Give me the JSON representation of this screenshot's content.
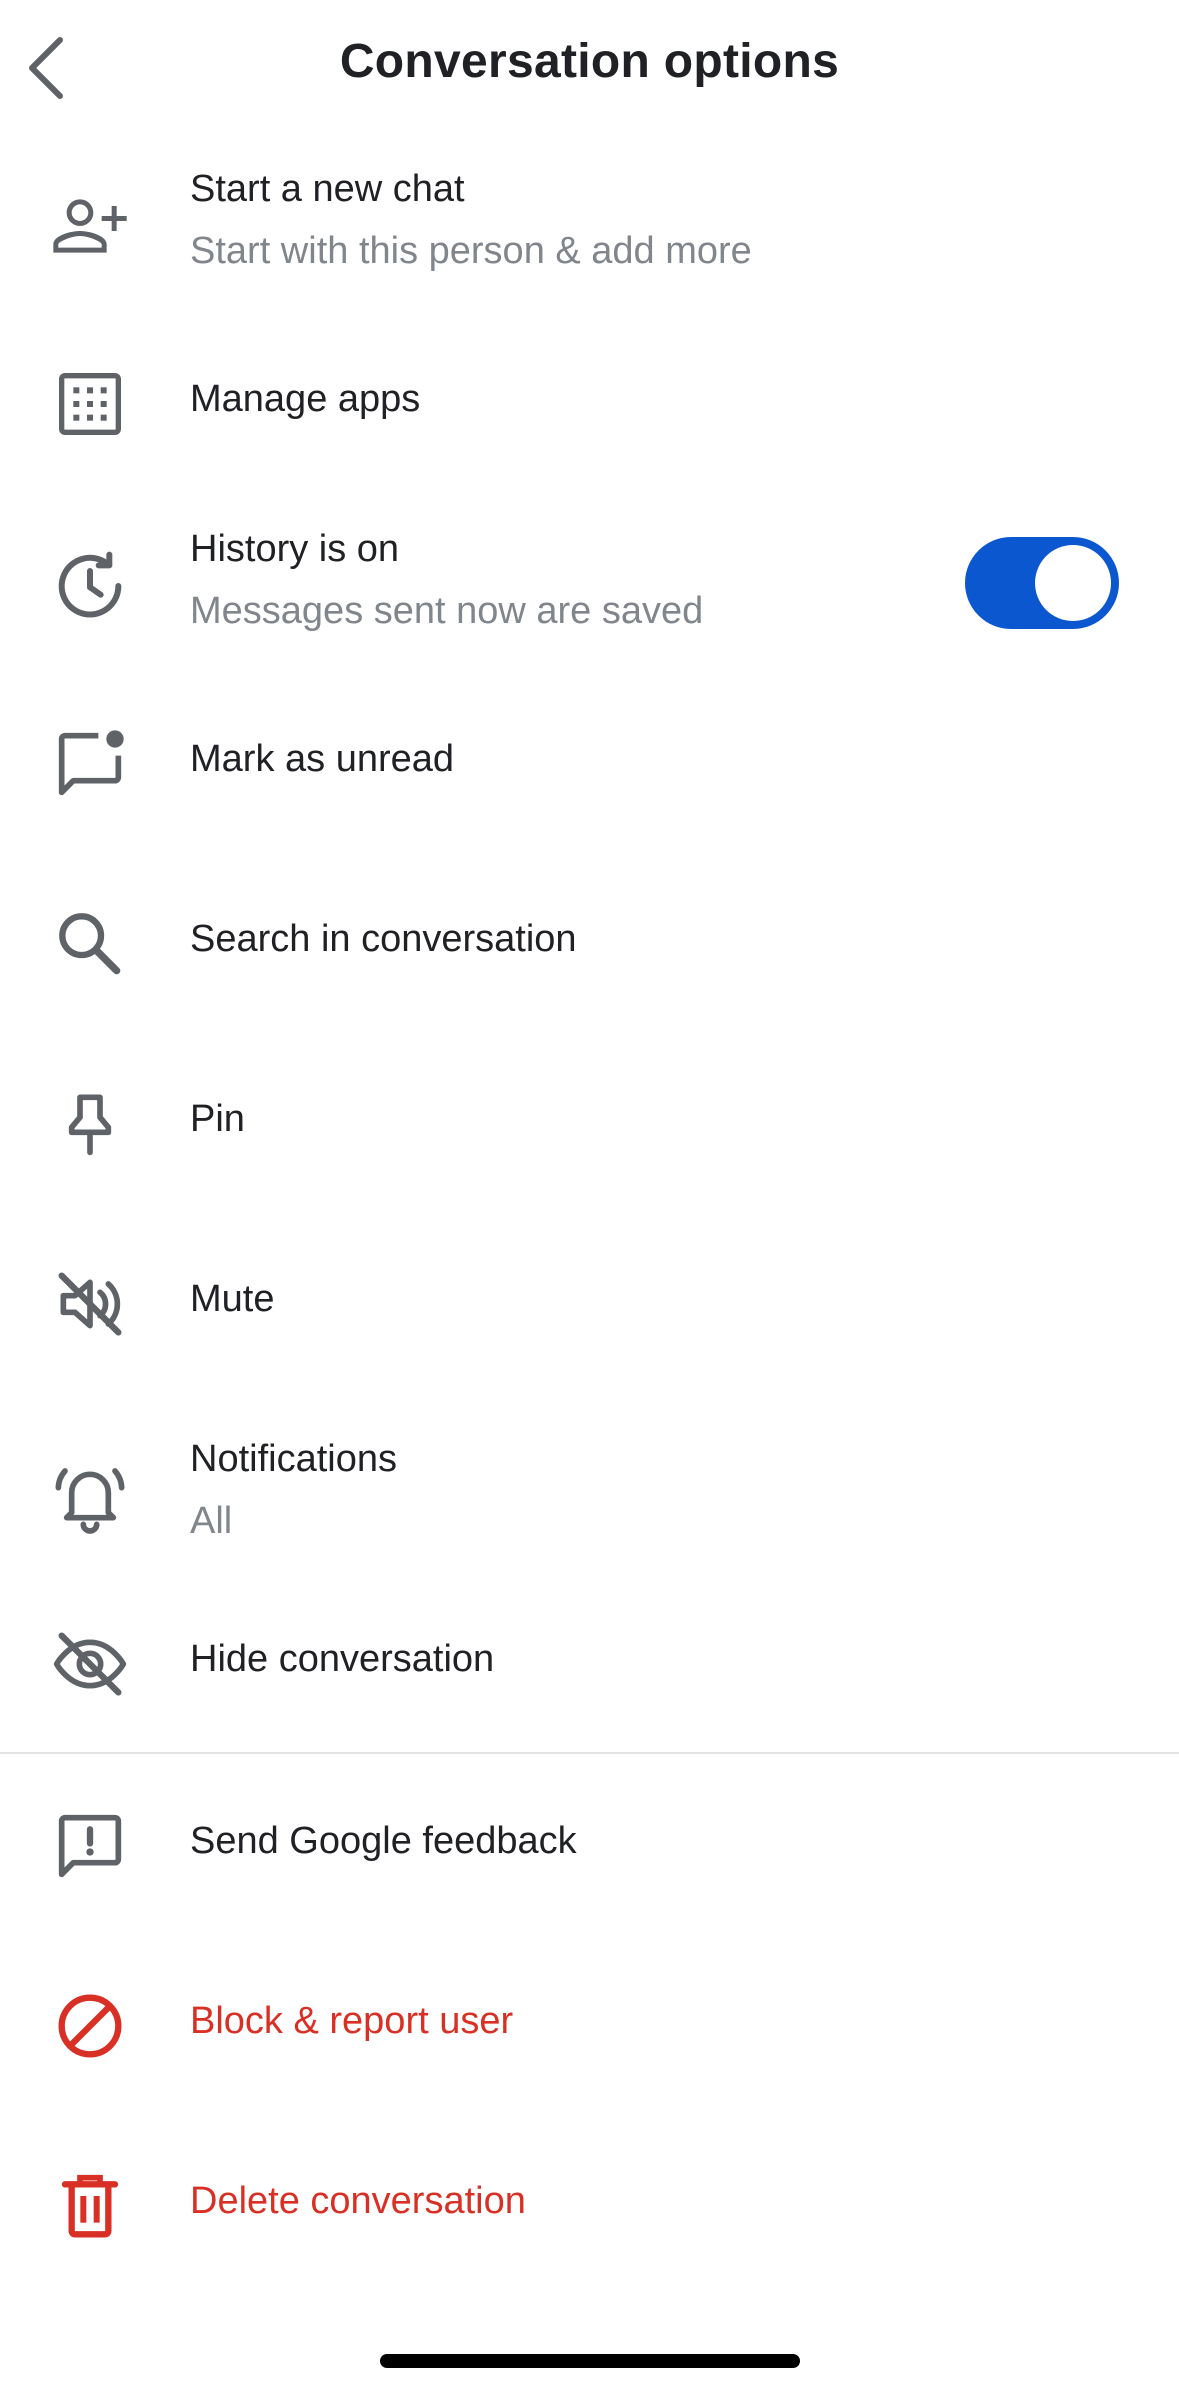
{
  "header": {
    "title": "Conversation options",
    "back_icon": "chevron-left-icon"
  },
  "items": [
    {
      "label": "Start a new chat",
      "subtitle": "Start with this person & add more",
      "icon": "person-add-icon"
    },
    {
      "label": "Manage apps",
      "icon": "apps-grid-icon"
    },
    {
      "label": "History is on",
      "subtitle": "Messages sent now are saved",
      "icon": "history-icon",
      "toggle_on": true
    },
    {
      "label": "Mark as unread",
      "icon": "mark-unread-icon"
    },
    {
      "label": "Search in conversation",
      "icon": "search-icon"
    },
    {
      "label": "Pin",
      "icon": "pin-icon"
    },
    {
      "label": "Mute",
      "icon": "mute-icon"
    },
    {
      "label": "Notifications",
      "subtitle": "All",
      "icon": "bell-icon"
    },
    {
      "label": "Hide conversation",
      "icon": "hide-eye-icon"
    },
    {
      "label": "Send Google feedback",
      "icon": "feedback-icon"
    },
    {
      "label": "Block & report user",
      "icon": "block-icon",
      "color": "#d93025"
    },
    {
      "label": "Delete conversation",
      "icon": "trash-icon",
      "color": "#d93025"
    }
  ],
  "colors": {
    "accent": "#0b57d0",
    "destructive": "#d93025",
    "secondary_text": "#80868b",
    "icon": "#5f6368"
  }
}
